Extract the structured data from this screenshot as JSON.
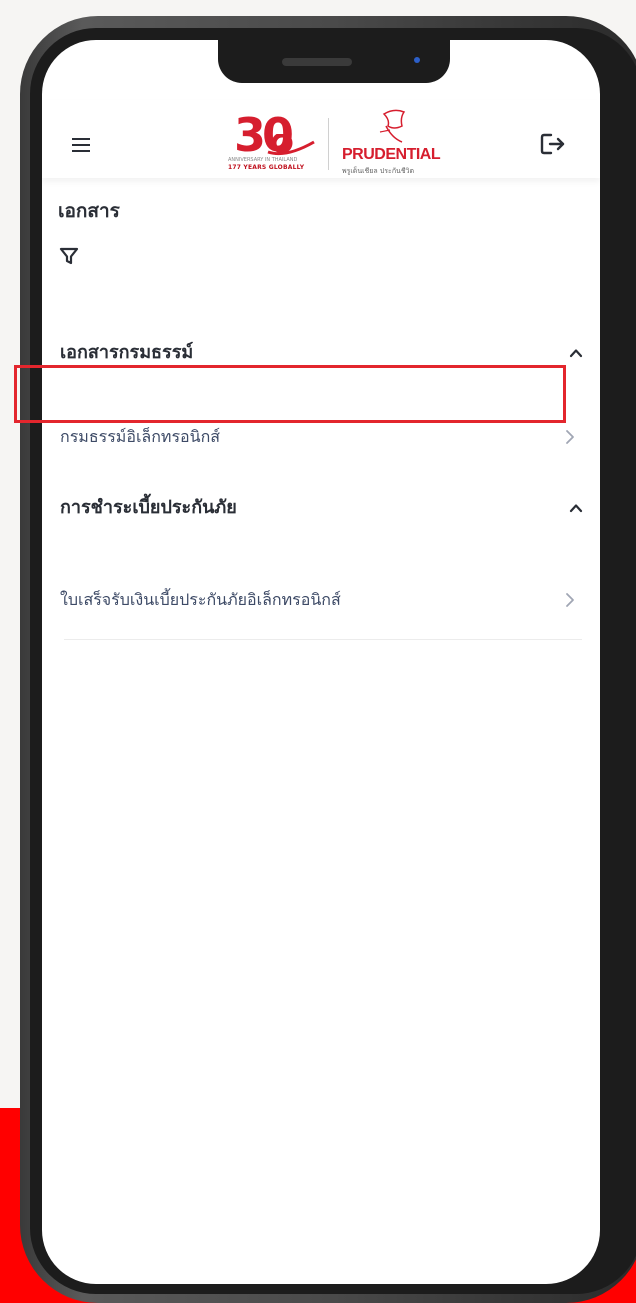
{
  "header": {
    "logo_anniversary": {
      "number": "30",
      "line1": "ANNIVERSARY IN THAILAND",
      "line2": "177 YEARS GLOBALLY"
    },
    "logo_brand": {
      "name": "PRUDENTIAL",
      "tagline": "พรูเด็นเชียล ประกันชีวิต"
    },
    "icons": {
      "menu": "hamburger-menu-icon",
      "logout": "logout-icon"
    }
  },
  "page": {
    "title": "เอกสาร",
    "filter_icon": "filter-icon"
  },
  "sections": [
    {
      "title": "เอกสารกรมธรรม์",
      "expanded": true,
      "items": [
        {
          "label": "กรมธรรม์อิเล็กทรอนิกส์",
          "highlighted": true
        }
      ]
    },
    {
      "title": "การชำระเบี้ยประกันภัย",
      "expanded": true,
      "items": [
        {
          "label": "ใบเสร็จรับเงินเบี้ยประกันภัยอิเล็กทรอนิกส์",
          "highlighted": false
        }
      ]
    }
  ],
  "colors": {
    "brand_red": "#d61e2e",
    "highlight_border": "#e3262d",
    "background_band": "#ff0000",
    "link_text": "#3d4a66"
  }
}
